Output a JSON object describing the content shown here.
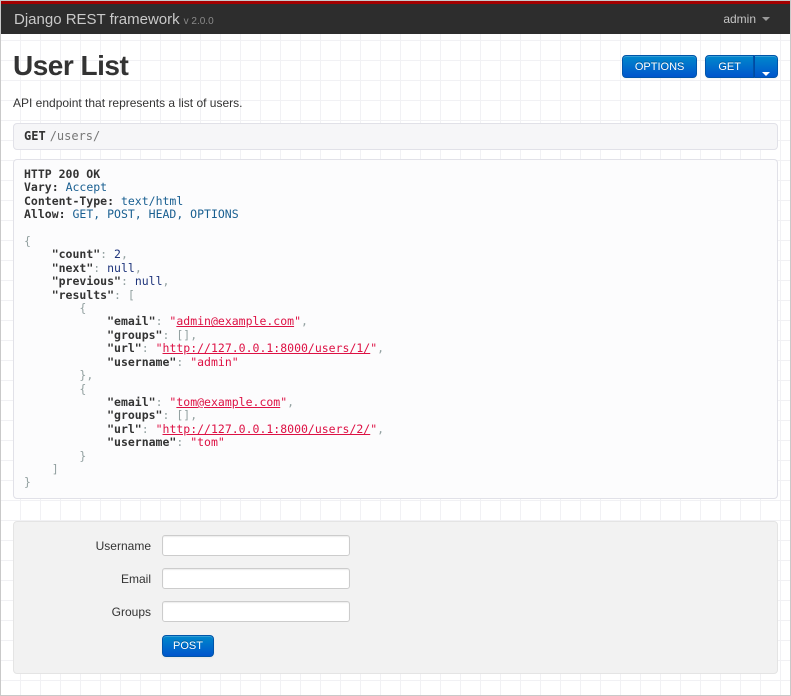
{
  "navbar": {
    "brand": "Django REST framework",
    "version": "v 2.0.0",
    "user_menu": "admin"
  },
  "page": {
    "title": "User List",
    "description": "API endpoint that represents a list of users."
  },
  "toolbar": {
    "options_label": "OPTIONS",
    "get_label": "GET"
  },
  "request": {
    "method": "GET",
    "path": "/users/"
  },
  "response": {
    "status_line": "HTTP 200 OK",
    "headers": {
      "Vary": "Accept",
      "Content-Type": "text/html",
      "Allow": "GET, POST, HEAD, OPTIONS"
    },
    "body": {
      "count": 2,
      "next": null,
      "previous": null,
      "results": [
        {
          "email": "admin@example.com",
          "groups": [],
          "url": "http://127.0.0.1:8000/users/1/",
          "username": "admin"
        },
        {
          "email": "tom@example.com",
          "groups": [],
          "url": "http://127.0.0.1:8000/users/2/",
          "username": "tom"
        }
      ]
    },
    "lines": [
      [
        [
          "hdr",
          "HTTP 200 OK"
        ]
      ],
      [
        [
          "hdr",
          "Vary:"
        ],
        [
          "pln",
          " "
        ],
        [
          "lit",
          "Accept"
        ]
      ],
      [
        [
          "hdr",
          "Content-Type:"
        ],
        [
          "pln",
          " "
        ],
        [
          "lit",
          "text/html"
        ]
      ],
      [
        [
          "hdr",
          "Allow:"
        ],
        [
          "pln",
          " "
        ],
        [
          "lit",
          "GET, POST, HEAD, OPTIONS"
        ]
      ],
      [],
      [
        [
          "pun",
          "{"
        ]
      ],
      [
        [
          "pln",
          "    "
        ],
        [
          "key",
          "\"count\""
        ],
        [
          "pun",
          ": "
        ],
        [
          "kwd",
          "2"
        ],
        [
          "pun",
          ","
        ]
      ],
      [
        [
          "pln",
          "    "
        ],
        [
          "key",
          "\"next\""
        ],
        [
          "pun",
          ": "
        ],
        [
          "kwd",
          "null"
        ],
        [
          "pun",
          ","
        ]
      ],
      [
        [
          "pln",
          "    "
        ],
        [
          "key",
          "\"previous\""
        ],
        [
          "pun",
          ": "
        ],
        [
          "kwd",
          "null"
        ],
        [
          "pun",
          ","
        ]
      ],
      [
        [
          "pln",
          "    "
        ],
        [
          "key",
          "\"results\""
        ],
        [
          "pun",
          ": ["
        ]
      ],
      [
        [
          "pln",
          "        "
        ],
        [
          "pun",
          "{"
        ]
      ],
      [
        [
          "pln",
          "            "
        ],
        [
          "key",
          "\"email\""
        ],
        [
          "pun",
          ": "
        ],
        [
          "str",
          "\""
        ],
        [
          "lnk",
          "admin@example.com"
        ],
        [
          "str",
          "\""
        ],
        [
          "pun",
          ","
        ]
      ],
      [
        [
          "pln",
          "            "
        ],
        [
          "key",
          "\"groups\""
        ],
        [
          "pun",
          ": "
        ],
        [
          "pun",
          "[]"
        ],
        [
          "pun",
          ","
        ]
      ],
      [
        [
          "pln",
          "            "
        ],
        [
          "key",
          "\"url\""
        ],
        [
          "pun",
          ": "
        ],
        [
          "str",
          "\""
        ],
        [
          "lnk",
          "http://127.0.0.1:8000/users/1/"
        ],
        [
          "str",
          "\""
        ],
        [
          "pun",
          ","
        ]
      ],
      [
        [
          "pln",
          "            "
        ],
        [
          "key",
          "\"username\""
        ],
        [
          "pun",
          ": "
        ],
        [
          "str",
          "\"admin\""
        ]
      ],
      [
        [
          "pln",
          "        "
        ],
        [
          "pun",
          "},"
        ]
      ],
      [
        [
          "pln",
          "        "
        ],
        [
          "pun",
          "{"
        ]
      ],
      [
        [
          "pln",
          "            "
        ],
        [
          "key",
          "\"email\""
        ],
        [
          "pun",
          ": "
        ],
        [
          "str",
          "\""
        ],
        [
          "lnk",
          "tom@example.com"
        ],
        [
          "str",
          "\""
        ],
        [
          "pun",
          ","
        ]
      ],
      [
        [
          "pln",
          "            "
        ],
        [
          "key",
          "\"groups\""
        ],
        [
          "pun",
          ": "
        ],
        [
          "pun",
          "[]"
        ],
        [
          "pun",
          ","
        ]
      ],
      [
        [
          "pln",
          "            "
        ],
        [
          "key",
          "\"url\""
        ],
        [
          "pun",
          ": "
        ],
        [
          "str",
          "\""
        ],
        [
          "lnk",
          "http://127.0.0.1:8000/users/2/"
        ],
        [
          "str",
          "\""
        ],
        [
          "pun",
          ","
        ]
      ],
      [
        [
          "pln",
          "            "
        ],
        [
          "key",
          "\"username\""
        ],
        [
          "pun",
          ": "
        ],
        [
          "str",
          "\"tom\""
        ]
      ],
      [
        [
          "pln",
          "        "
        ],
        [
          "pun",
          "}"
        ]
      ],
      [
        [
          "pln",
          "    "
        ],
        [
          "pun",
          "]"
        ]
      ],
      [
        [
          "pun",
          "}"
        ]
      ]
    ]
  },
  "form": {
    "fields": [
      {
        "name": "username",
        "label": "Username",
        "value": "",
        "placeholder": ""
      },
      {
        "name": "email",
        "label": "Email",
        "value": "",
        "placeholder": ""
      },
      {
        "name": "groups",
        "label": "Groups",
        "value": "",
        "placeholder": ""
      }
    ],
    "submit_label": "POST"
  },
  "colors": {
    "topline_red": "#a20000",
    "navbar_bg": "#2d2d2d",
    "accent_blue_top": "#0088cc",
    "accent_blue_bottom": "#0055cc",
    "code_string": "#dd1144",
    "code_keyword": "#1e347b",
    "code_literal": "#195f91",
    "code_punctuation": "#93a1a1"
  }
}
